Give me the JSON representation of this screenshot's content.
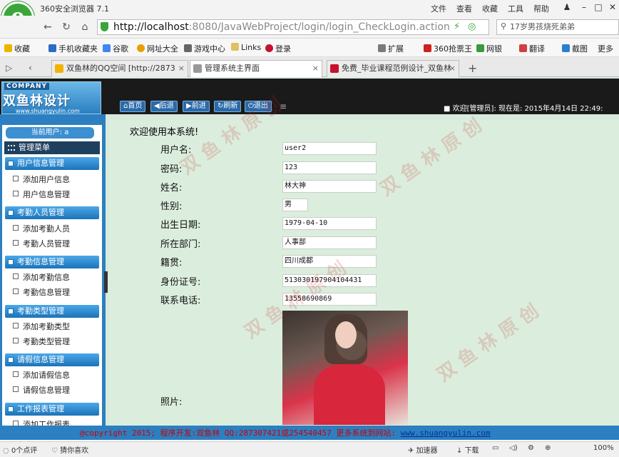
{
  "browser": {
    "app_title": "360安全浏览器 7.1",
    "menu": [
      "文件",
      "查看",
      "收藏",
      "工具",
      "帮助"
    ],
    "url_host": "http://localhost",
    "url_rest": ":8080/JavaWebProject/login/login_CheckLogin.action",
    "search_text": "17岁男孩烧死弟弟",
    "bookmarks": [
      "收藏",
      "手机收藏夹",
      "谷歌",
      "网址大全",
      "游戏中心",
      "Links",
      "登录"
    ],
    "toolbar_items": [
      "扩展",
      "360抢票王",
      "网银",
      "翻译",
      "截图",
      "更多"
    ],
    "tabs": [
      {
        "label": "双鱼林的QQ空间 [http://2873",
        "active": false
      },
      {
        "label": "管理系统主界面",
        "active": true
      },
      {
        "label": "免费_毕业课程范例设计_双鱼林",
        "active": false
      }
    ],
    "status": {
      "comments": "0个点评",
      "guess": "猜你喜欢",
      "accelerator": "加速器",
      "download": "下载",
      "zoom": "100%"
    }
  },
  "site": {
    "company": "COMPANY",
    "logo_text": "双鱼林设计",
    "logo_url": "www.shuangyulin.com",
    "top_buttons": [
      "首页",
      "后退",
      "前进",
      "刷新",
      "退出"
    ],
    "welcome": "欢迎[管理员]:  现在是: 2015年4月14日 22:49:",
    "current_user_label": "当前用户: a",
    "menu_title": "管理菜单",
    "menu_groups": [
      {
        "title": "用户信息管理",
        "items": [
          "添加用户信息",
          "用户信息管理"
        ]
      },
      {
        "title": "考勤人员管理",
        "items": [
          "添加考勤人员",
          "考勤人员管理"
        ]
      },
      {
        "title": "考勤信息管理",
        "items": [
          "添加考勤信息",
          "考勤信息管理"
        ]
      },
      {
        "title": "考勤类型管理",
        "items": [
          "添加考勤类型",
          "考勤类型管理"
        ]
      },
      {
        "title": "请假信息管理",
        "items": [
          "添加请假信息",
          "请假信息管理"
        ]
      },
      {
        "title": "工作报表管理",
        "items": [
          "添加工作报表"
        ]
      }
    ],
    "main_title": "欢迎使用本系统!",
    "fields": [
      {
        "label": "用户名:",
        "value": "user2"
      },
      {
        "label": "密码:",
        "value": "123"
      },
      {
        "label": "姓名:",
        "value": "林大神"
      },
      {
        "label": "性别:",
        "value": "男"
      },
      {
        "label": "出生日期:",
        "value": "1979-04-10"
      },
      {
        "label": "所在部门:",
        "value": "人事部"
      },
      {
        "label": "籍贯:",
        "value": "四川成都"
      },
      {
        "label": "身份证号:",
        "value": "513030197904104431"
      },
      {
        "label": "联系电话:",
        "value": "13558690869"
      }
    ],
    "photo_label": "照片:",
    "footer": "@copyright 2015; 程序开发:双鱼林   QQ:287307421或254540457   更多系统到网站:",
    "footer_link": "www.shuangyulin.com"
  }
}
